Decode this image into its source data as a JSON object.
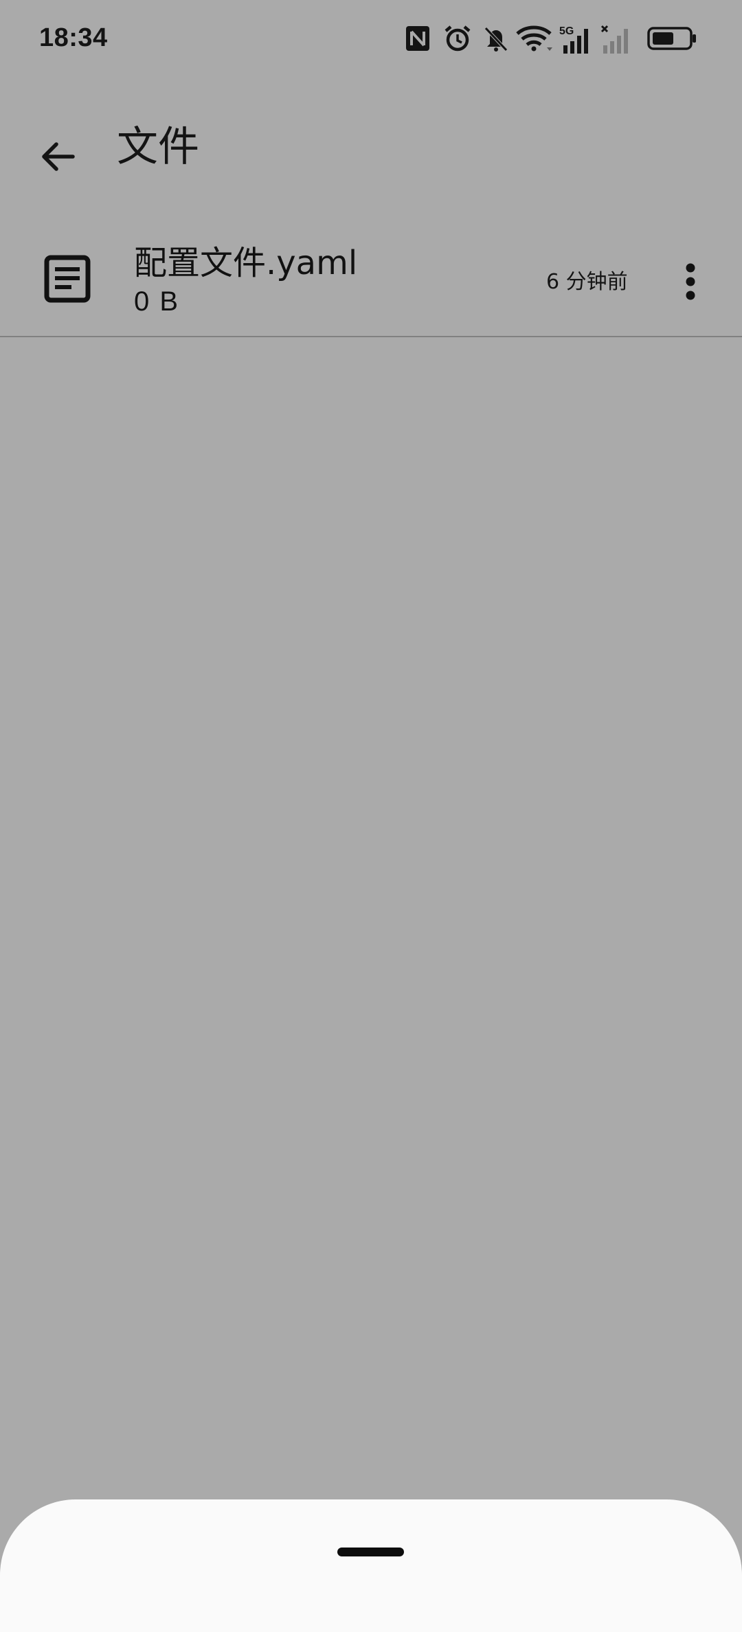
{
  "status_bar": {
    "time": "18:34",
    "icons": [
      "nfc-icon",
      "alarm-icon",
      "notifications-off-icon",
      "wifi-icon",
      "signal-5g-icon",
      "signal-no-sim-icon",
      "battery-icon"
    ],
    "network_label": "5G"
  },
  "app_bar": {
    "back_icon": "arrow-back-icon",
    "title": "文件"
  },
  "files": [
    {
      "icon": "document-icon",
      "name": "配置文件.yaml",
      "size": "0 B",
      "modified": "6 分钟前",
      "menu_icon": "more-vert-icon"
    }
  ],
  "colors": {
    "scrim_background": "#aaaaaa",
    "sheet_background": "#fafafa",
    "divider": "#808080",
    "text_primary": "#111111"
  }
}
